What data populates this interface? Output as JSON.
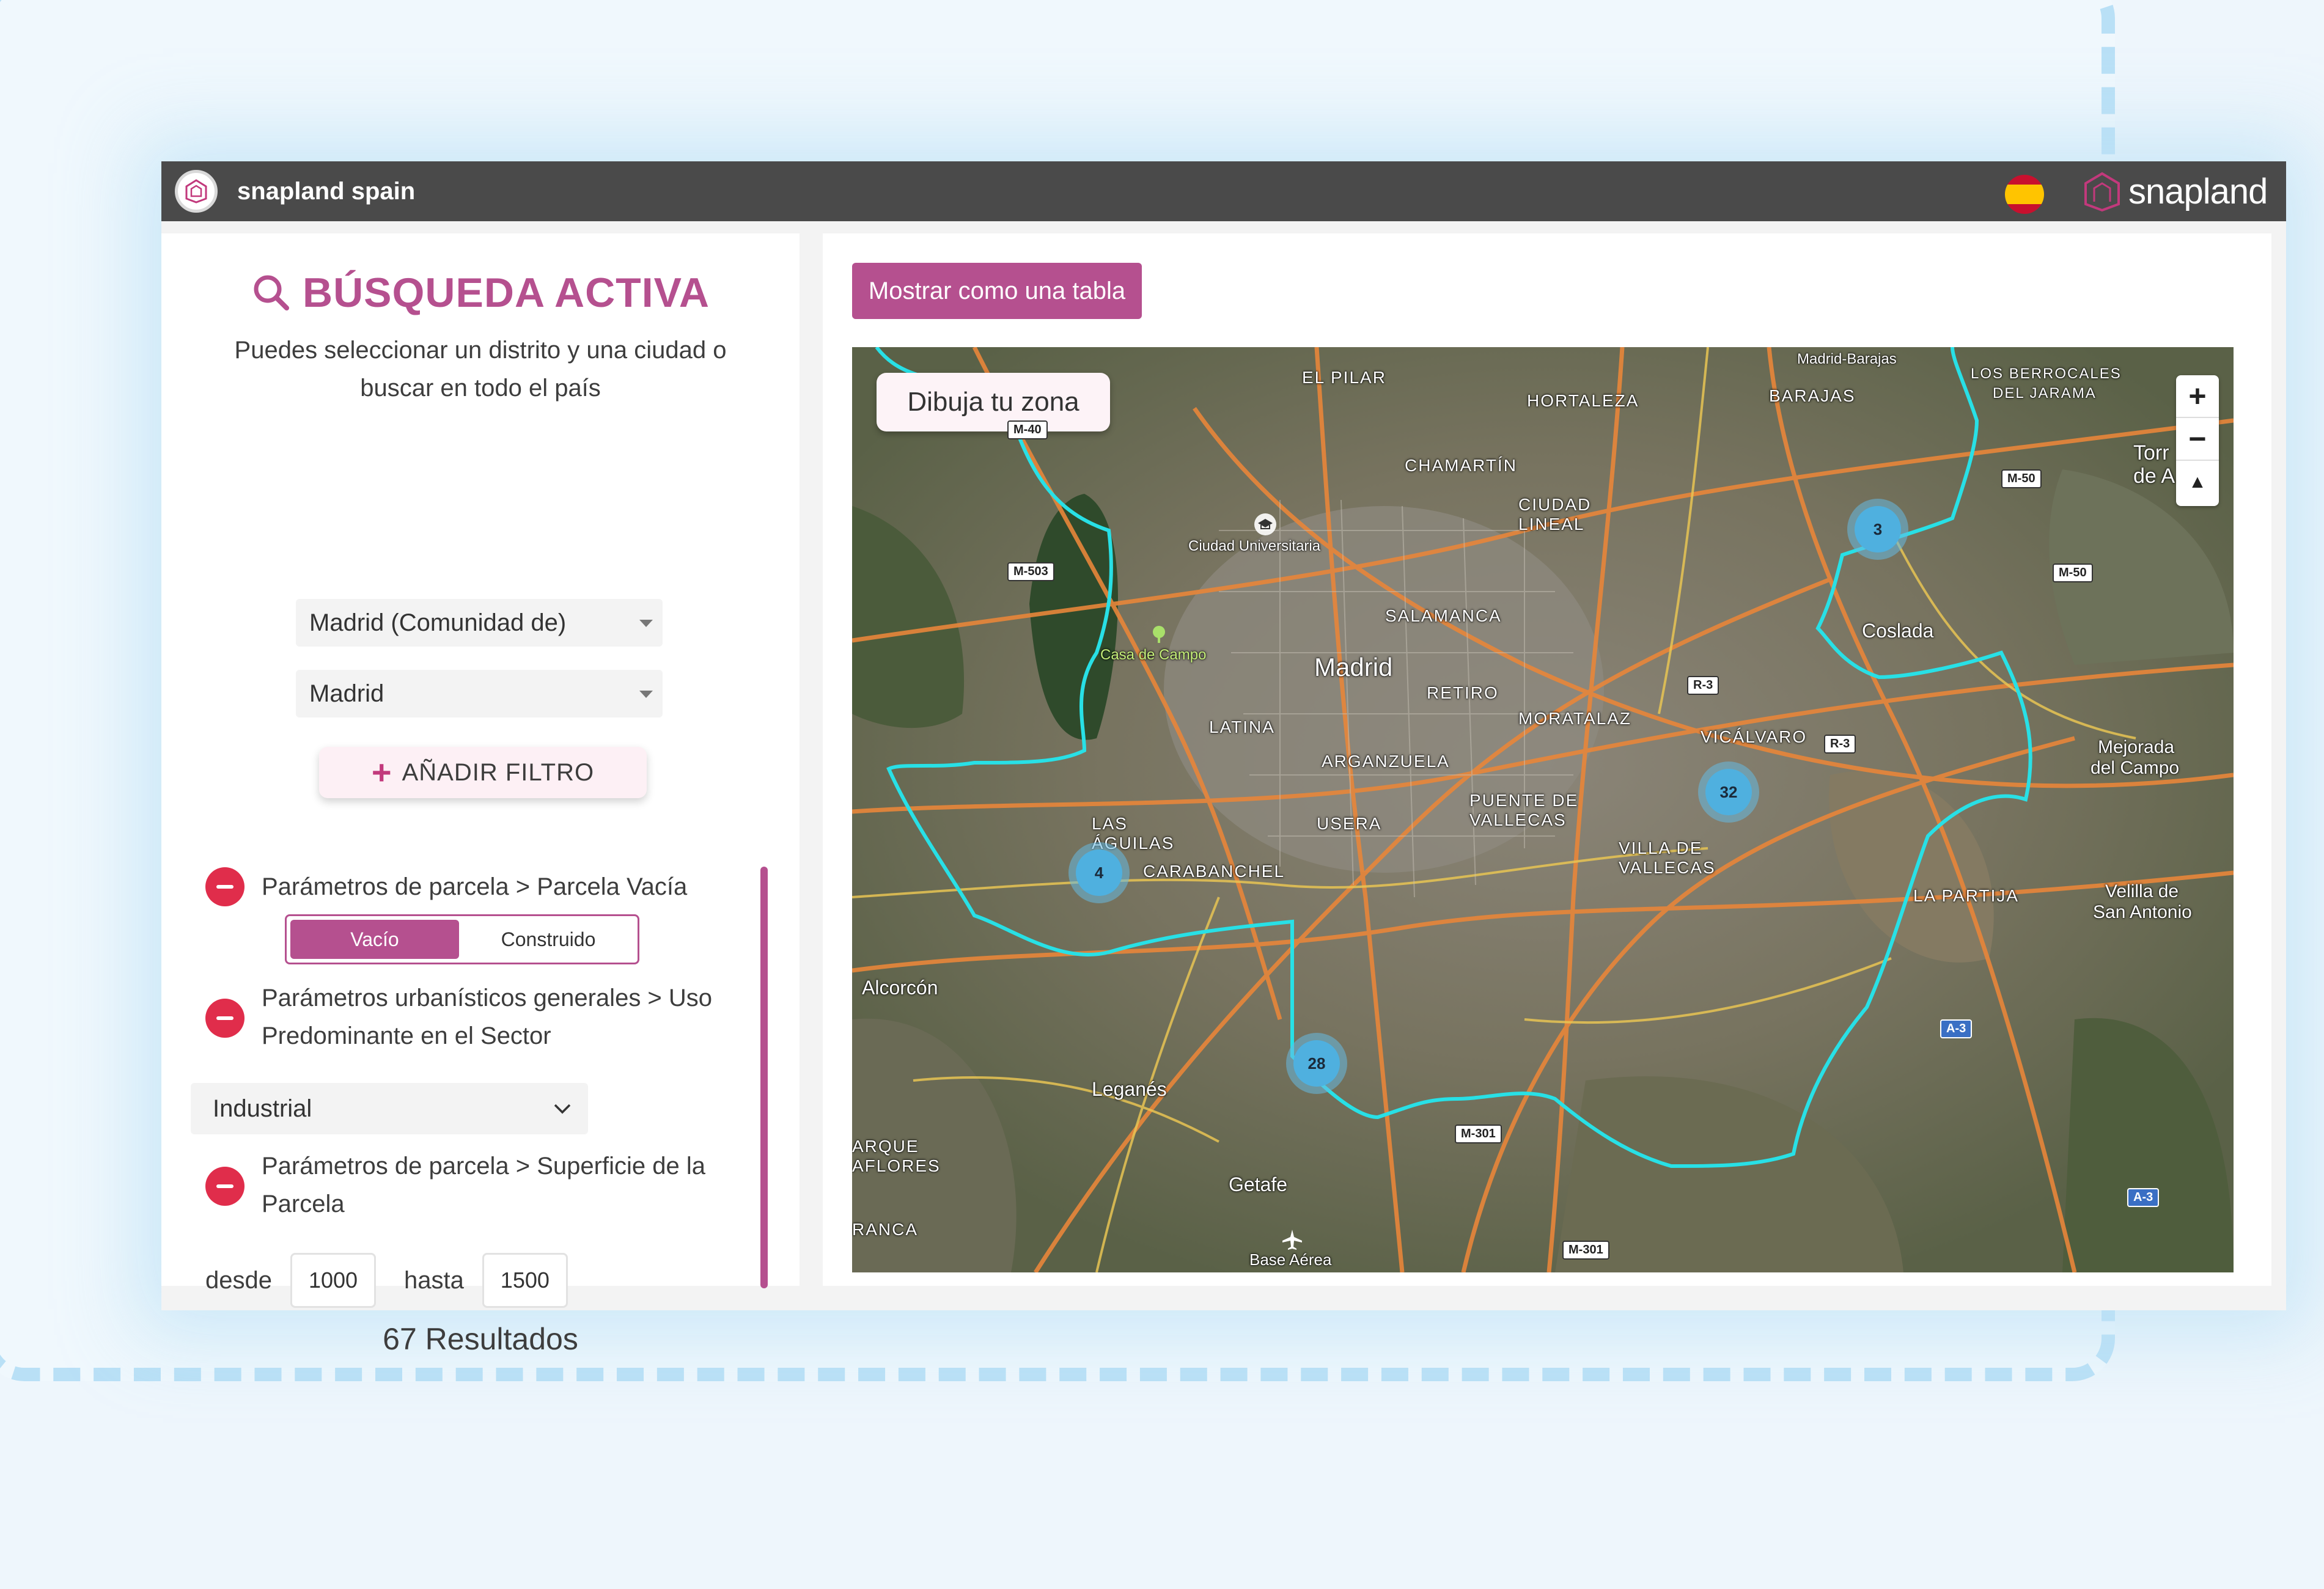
{
  "header": {
    "app_title": "snapland spain",
    "brand_name": "snapland",
    "language_flag": "spain-flag-icon"
  },
  "search": {
    "title": "BÚSQUEDA ACTIVA",
    "subtitle": "Puedes seleccionar un distrito y una ciudad o buscar en todo el país",
    "region_select": "Madrid (Comunidad de)",
    "city_select": "Madrid",
    "add_filter_label": "AÑADIR FILTRO"
  },
  "filters": [
    {
      "label": "Parámetros de parcela > Parcela Vacía",
      "toggle_on": "Vacío",
      "toggle_off": "Construido"
    },
    {
      "label": "Parámetros urbanísticos generales > Uso Predominante en el Sector",
      "value": "Industrial"
    },
    {
      "label": "Parámetros de parcela > Superficie de la Parcela",
      "from_label": "desde",
      "from_value": "1000",
      "to_label": "hasta",
      "to_value": "1500"
    }
  ],
  "results_label": "67 Resultados",
  "map": {
    "table_button": "Mostrar como una tabla",
    "draw_zone_button": "Dibuja tu zona",
    "zoom_in": "+",
    "zoom_out": "−",
    "compass": "▲",
    "clusters": [
      "3",
      "32",
      "4",
      "28"
    ],
    "labels": {
      "madrid": "Madrid",
      "coslada": "Coslada",
      "alcorcon": "Alcorcón",
      "leganes": "Leganés",
      "getafe": "Getafe",
      "casa_de_campo": "Casa de Campo",
      "ciudad_universitaria": "Ciudad Universitaria",
      "el_pilar": "EL PILAR",
      "hortaleza": "HORTALEZA",
      "barajas": "BARAJAS",
      "madrid_barajas": "Madrid-Barajas",
      "berrocales": "LOS BERROCALES",
      "del_jarama": "DEL JARAMA",
      "chamartin": "CHAMARTÍN",
      "ciudad_lineal_1": "CIUDAD",
      "ciudad_lineal_2": "LINEAL",
      "salamanca": "SALAMANCA",
      "retiro": "RETIRO",
      "moratalaz": "MORATALAZ",
      "vicalvaro": "VICÁLVARO",
      "latina": "LATINA",
      "arganzuela": "ARGANZUELA",
      "usera": "USERA",
      "puente_1": "PUENTE DE",
      "puente_2": "VALLECAS",
      "villa_1": "VILLA DE",
      "villa_2": "VALLECAS",
      "aguilas_1": "LAS",
      "aguilas_2": "ÁGUILAS",
      "carabanchel": "CARABANCHEL",
      "la_partija": "LA PARTIJA",
      "mejorada_1": "Mejorada",
      "mejorada_2": "del Campo",
      "velilla_1": "Velilla de",
      "velilla_2": "San Antonio",
      "torr_1": "Torr",
      "torr_2": "de A",
      "parque_1": "ARQUE",
      "parque_2": "AFLORES",
      "rancha": "RANCA",
      "base_aerea": "Base Aérea"
    },
    "shields": [
      "M-40",
      "M-503",
      "M-50",
      "M-50",
      "R-3",
      "R-3",
      "A-3",
      "A-3",
      "M-301",
      "M-301"
    ]
  },
  "colors": {
    "accent": "#b5508f",
    "danger": "#e02d4b",
    "boundary": "#28e0e6",
    "cluster": "#4fb0df",
    "topbar": "#4a4a4a"
  }
}
